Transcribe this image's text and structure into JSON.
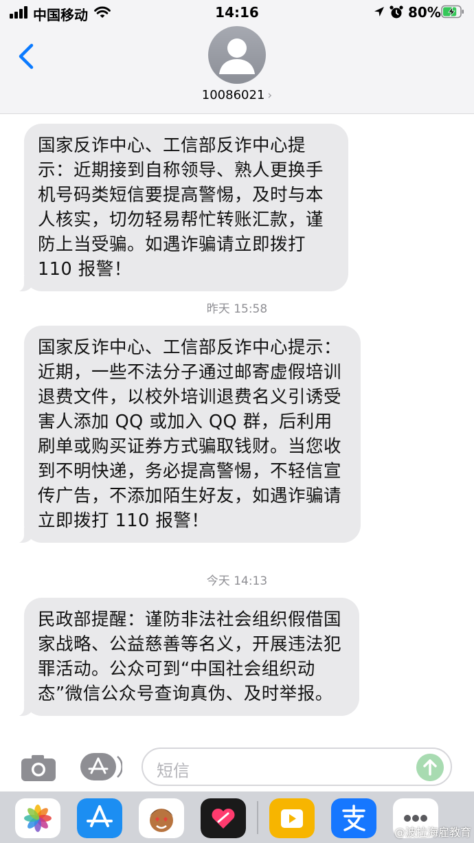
{
  "status_bar": {
    "carrier": "中国移动",
    "time": "14:16",
    "battery_percent": "80%",
    "battery_level": 0.8,
    "signal_bars": 4,
    "icons": [
      "signal-icon",
      "wifi-icon",
      "location-icon",
      "alarm-icon",
      "battery-charging-icon"
    ]
  },
  "header": {
    "back_icon": "chevron-left-icon",
    "contact_name": "10086021",
    "contact_chevron": "›"
  },
  "messages": [
    {
      "type": "received",
      "text": "国家反诈中心、工信部反诈中心提示：近期接到自称领导、熟人更换手机号码类短信要提高警惕，及时与本人核实，切勿轻易帮忙转账汇款，谨防上当受骗。如遇诈骗请立即拨打 110 报警！"
    },
    {
      "type": "timestamp",
      "text": "昨天 15:58"
    },
    {
      "type": "received",
      "text": "国家反诈中心、工信部反诈中心提示：近期，一些不法分子通过邮寄虚假培训退费文件，以校外培训退费名义引诱受害人添加 QQ 或加入 QQ 群，后利用刷单或购买证券方式骗取钱财。当您收到不明快递，务必提高警惕，不轻信宣传广告，不添加陌生好友，如遇诈骗请立即拨打 110 报警！"
    },
    {
      "type": "timestamp",
      "text": "今天 14:13"
    },
    {
      "type": "received",
      "text": "民政部提醒：谨防非法社会组织假借国家战略、公益慈善等名义，开展违法犯罪活动。公众可到“中国社会组织动态”微信公众号查询真伪、及时举报。"
    }
  ],
  "input_bar": {
    "placeholder": "短信",
    "camera_icon": "camera-icon",
    "apps_icon": "app-store-icon",
    "send_icon": "send-arrow-icon"
  },
  "app_drawer": {
    "apps": [
      "photos-icon",
      "app-store-icon",
      "memoji-icon",
      "digital-touch-icon",
      "video-icon",
      "alipay-icon",
      "more-icon"
    ]
  },
  "watermark": "@波拉海雇教育",
  "colors": {
    "bubble": "#e9e9eb",
    "ios_blue": "#0a7aff",
    "send_disabled": "#a8dbb1",
    "timestamp": "#8e8e93"
  }
}
